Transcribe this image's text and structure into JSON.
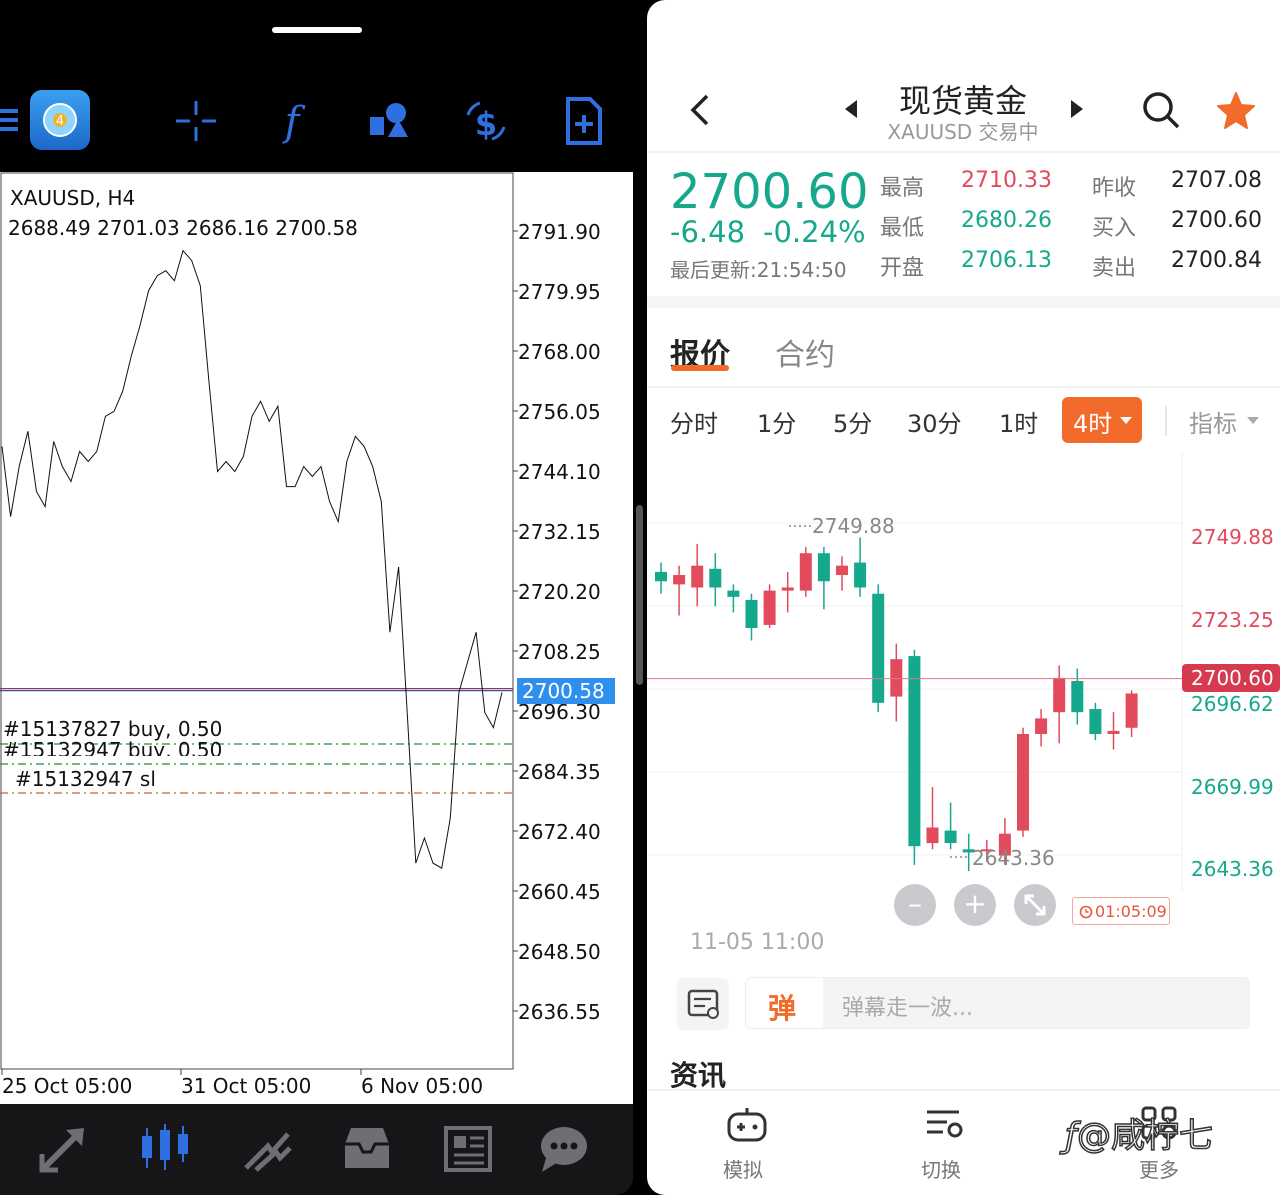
{
  "mt": {
    "symbol": "XAUUSD, H4",
    "ohlc": "2688.49 2701.03 2686.16 2700.58",
    "price_axis": [
      "2791.90",
      "2779.95",
      "2768.00",
      "2756.05",
      "2744.10",
      "2732.15",
      "2720.20",
      "2708.25",
      "2696.30",
      "2684.35",
      "2672.40",
      "2660.45",
      "2648.50",
      "2636.55"
    ],
    "current_price": "2700.58",
    "orders": [
      "#15137827 buy, 0.50",
      "#15132947 buy, 0.50",
      "#15132947 sl"
    ],
    "time_axis": [
      "25 Oct 05:00",
      "31 Oct 05:00",
      "6 Nov 05:00"
    ],
    "line_series": [
      2749,
      2735,
      2745,
      2752,
      2740,
      2737,
      2750,
      2745,
      2742,
      2748,
      2746,
      2748,
      2755,
      2756,
      2760,
      2767,
      2773,
      2780,
      2783,
      2784,
      2782,
      2788,
      2786,
      2781,
      2762,
      2744,
      2746,
      2744,
      2747,
      2755,
      2758,
      2754,
      2757,
      2741,
      2741,
      2745,
      2743,
      2745,
      2738,
      2734,
      2746,
      2751,
      2749,
      2745,
      2738,
      2712,
      2725,
      2696,
      2666,
      2671,
      2666,
      2665,
      2675,
      2700,
      2706,
      2712,
      2696,
      2693,
      2700
    ]
  },
  "right": {
    "title": "现货黄金",
    "subtitle": "XAUUSD 交易中",
    "price": "2700.60",
    "change": "-6.48",
    "change_pct": "-0.24%",
    "updated": "最后更新:21:54:50",
    "stats": {
      "high_label": "最高",
      "high": "2710.33",
      "low_label": "最低",
      "low": "2680.26",
      "open_label": "开盘",
      "open": "2706.13",
      "prev_label": "昨收",
      "prev": "2707.08",
      "bid_label": "买入",
      "bid": "2700.60",
      "ask_label": "卖出",
      "ask": "2700.84"
    },
    "tabs": [
      "报价",
      "合约"
    ],
    "timeframes": [
      "分时",
      "1分",
      "5分",
      "30分",
      "1时"
    ],
    "active_tf": "4时",
    "indicator": "指标",
    "axis": {
      "a1": "2749.88",
      "a2": "2723.25",
      "cur": "2700.60",
      "a3": "2696.62",
      "a4": "2669.99",
      "a5": "2643.36"
    },
    "hi_mark": "2749.88",
    "lo_mark": "2643.36",
    "countdown": "01:05:09",
    "date_label": "11-05 11:00",
    "danmaku_placeholder": "弹幕走一波...",
    "danmaku_badge": "弹",
    "news_title": "资讯",
    "bottom_nav": [
      "模拟",
      "切换",
      "更多"
    ],
    "watermark": "@咸柠七",
    "candles": [
      {
        "o": 2739,
        "c": 2736,
        "h": 2742,
        "l": 2732
      },
      {
        "o": 2735,
        "c": 2738,
        "h": 2741,
        "l": 2725
      },
      {
        "o": 2734,
        "c": 2741,
        "h": 2748,
        "l": 2728
      },
      {
        "o": 2740,
        "c": 2734,
        "h": 2745,
        "l": 2728
      },
      {
        "o": 2733,
        "c": 2731,
        "h": 2735,
        "l": 2726
      },
      {
        "o": 2730,
        "c": 2721,
        "h": 2732,
        "l": 2717
      },
      {
        "o": 2722,
        "c": 2733,
        "h": 2735,
        "l": 2721
      },
      {
        "o": 2733,
        "c": 2734,
        "h": 2739,
        "l": 2726
      },
      {
        "o": 2733,
        "c": 2745,
        "h": 2747,
        "l": 2731
      },
      {
        "o": 2745,
        "c": 2736,
        "h": 2747,
        "l": 2727
      },
      {
        "o": 2738,
        "c": 2741,
        "h": 2744,
        "l": 2733
      },
      {
        "o": 2742,
        "c": 2734,
        "h": 2750,
        "l": 2731
      },
      {
        "o": 2732,
        "c": 2697,
        "h": 2735,
        "l": 2694
      },
      {
        "o": 2699,
        "c": 2711,
        "h": 2716,
        "l": 2691
      },
      {
        "o": 2712,
        "c": 2651,
        "h": 2714,
        "l": 2645
      },
      {
        "o": 2652,
        "c": 2657,
        "h": 2670,
        "l": 2650
      },
      {
        "o": 2656,
        "c": 2652,
        "h": 2665,
        "l": 2650
      },
      {
        "o": 2650,
        "c": 2649,
        "h": 2655,
        "l": 2643
      },
      {
        "o": 2650,
        "c": 2650,
        "h": 2653,
        "l": 2646
      },
      {
        "o": 2648,
        "c": 2655,
        "h": 2660,
        "l": 2645
      },
      {
        "o": 2656,
        "c": 2687,
        "h": 2689,
        "l": 2654
      },
      {
        "o": 2687,
        "c": 2692,
        "h": 2695,
        "l": 2683
      },
      {
        "o": 2694,
        "c": 2705,
        "h": 2709,
        "l": 2684
      },
      {
        "o": 2704,
        "c": 2694,
        "h": 2708,
        "l": 2690
      },
      {
        "o": 2695,
        "c": 2687,
        "h": 2697,
        "l": 2685
      },
      {
        "o": 2687,
        "c": 2688,
        "h": 2694,
        "l": 2682
      },
      {
        "o": 2689,
        "c": 2700,
        "h": 2701,
        "l": 2686
      }
    ]
  }
}
